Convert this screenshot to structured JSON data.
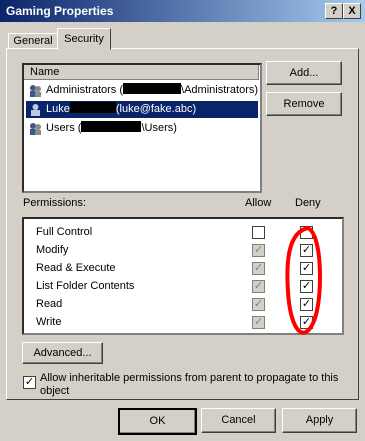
{
  "window": {
    "title": "Gaming Properties",
    "help_button": "?",
    "close_button": "X"
  },
  "tabs": [
    {
      "label": "General",
      "active": false
    },
    {
      "label": "Security",
      "active": true
    }
  ],
  "names_list": {
    "header": "Name",
    "rows": [
      {
        "prefix": "Administrators (",
        "suffix": "\\Administrators)",
        "selected": false
      },
      {
        "prefix": "Luke",
        "suffix": "(luke@fake.abc)",
        "selected": true
      },
      {
        "prefix": "Users (",
        "suffix": "\\Users)",
        "selected": false
      }
    ]
  },
  "buttons": {
    "add": "Add...",
    "remove": "Remove",
    "advanced": "Advanced...",
    "ok": "OK",
    "cancel": "Cancel",
    "apply": "Apply"
  },
  "permissions": {
    "label": "Permissions:",
    "allow_header": "Allow",
    "deny_header": "Deny",
    "rows": [
      {
        "name": "Full Control",
        "allow": false,
        "deny": false
      },
      {
        "name": "Modify",
        "allow": true,
        "deny": true
      },
      {
        "name": "Read & Execute",
        "allow": true,
        "deny": true
      },
      {
        "name": "List Folder Contents",
        "allow": true,
        "deny": true
      },
      {
        "name": "Read",
        "allow": true,
        "deny": true
      },
      {
        "name": "Write",
        "allow": true,
        "deny": true
      }
    ]
  },
  "inherit": {
    "checked": true,
    "label": "Allow inheritable permissions from parent to propagate to this object"
  },
  "colors": {
    "titlebar_start": "#0a246a",
    "titlebar_end": "#a6caf0",
    "selection": "#0a246a",
    "annotation": "#ff0000",
    "face": "#d4d0c8"
  }
}
